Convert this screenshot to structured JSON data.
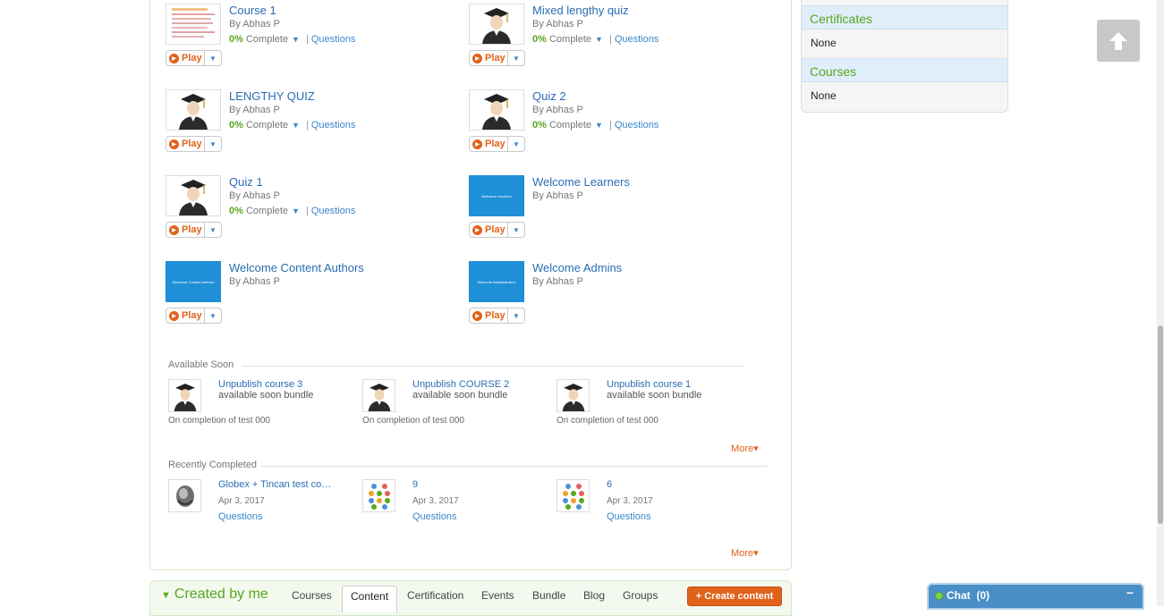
{
  "courses": [
    {
      "title": "Course 1",
      "author": "By Abhas P",
      "pct": "0%",
      "complete": "Complete",
      "questions": "Questions",
      "thumb": "document-thumbnail",
      "play": "Play"
    },
    {
      "title": "Mixed lengthy quiz",
      "author": "By Abhas P",
      "pct": "0%",
      "complete": "Complete",
      "questions": "Questions",
      "thumb": "graduate-avatar",
      "play": "Play"
    },
    {
      "title": "LENGTHY QUIZ",
      "author": "By Abhas P",
      "pct": "0%",
      "complete": "Complete",
      "questions": "Questions",
      "thumb": "graduate-avatar",
      "play": "Play"
    },
    {
      "title": "Quiz 2",
      "author": "By Abhas P",
      "pct": "0%",
      "complete": "Complete",
      "questions": "Questions",
      "thumb": "graduate-avatar",
      "play": "Play"
    },
    {
      "title": "Quiz 1",
      "author": "By Abhas P",
      "pct": "0%",
      "complete": "Complete",
      "questions": "Questions",
      "thumb": "graduate-avatar",
      "play": "Play"
    },
    {
      "title": "Welcome Learners",
      "author": "By Abhas P",
      "thumb": "blue-banner",
      "thumb_text": "Welcome Learners",
      "play": "Play"
    },
    {
      "title": "Welcome Content Authors",
      "author": "By Abhas P",
      "thumb": "blue-banner",
      "thumb_text": "Welcome Content Authors",
      "play": "Play"
    },
    {
      "title": "Welcome Admins",
      "author": "By Abhas P",
      "thumb": "blue-banner",
      "thumb_text": "Welcome Administrators",
      "play": "Play"
    }
  ],
  "available_soon": {
    "label": "Available Soon",
    "items": [
      {
        "title": "Unpublish course 3",
        "sub": "available soon bundle",
        "foot": "On completion of test 000"
      },
      {
        "title": "Unpublish COURSE 2",
        "sub": "available soon bundle",
        "foot": "On completion of test 000"
      },
      {
        "title": "Unpublish course 1",
        "sub": "available soon bundle",
        "foot": "On completion of test 000"
      }
    ],
    "more": "More"
  },
  "recently_completed": {
    "label": "Recently Completed",
    "items": [
      {
        "title": "Globex + Tincan test co…",
        "date": "Apr 3, 2017",
        "questions": "Questions",
        "thumb": "helmet-icon"
      },
      {
        "title": "9",
        "date": "Apr 3, 2017",
        "questions": "Questions",
        "thumb": "dots-grid-icon"
      },
      {
        "title": "6",
        "date": "Apr 3, 2017",
        "questions": "Questions",
        "thumb": "dots-grid-icon"
      }
    ],
    "more": "More"
  },
  "sidebar": {
    "certificates_label": "Certificates",
    "certificates_value": "None",
    "courses_label": "Courses",
    "courses_value": "None"
  },
  "created_by_me": {
    "title": "Created by me",
    "tabs": [
      "Courses",
      "Content",
      "Certification",
      "Events",
      "Bundle",
      "Blog",
      "Groups"
    ],
    "active_tab": "Content",
    "create_button": "+ Create content"
  },
  "chat": {
    "label": "Chat",
    "count": "(0)",
    "minimize": "−"
  },
  "colors": {
    "accent_orange": "#e0621a",
    "link_blue": "#3a87c8",
    "green": "#5aa61f",
    "chat_blue": "#4a8ec8"
  }
}
